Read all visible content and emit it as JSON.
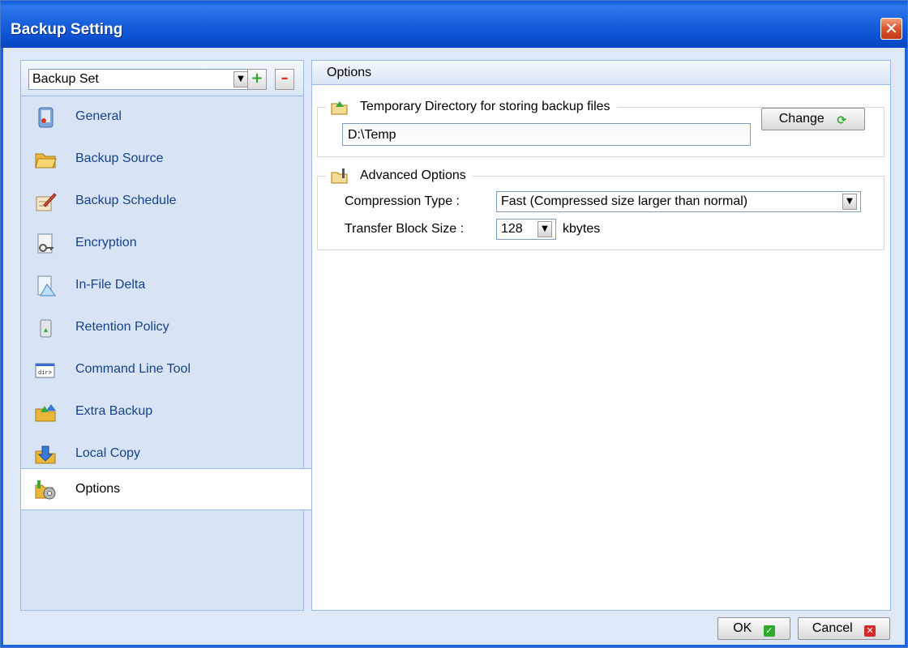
{
  "window": {
    "title": "Backup Setting",
    "close_symbol": "✕"
  },
  "sidebar": {
    "backup_set_select": {
      "value": "Backup Set",
      "arrow": "▼"
    },
    "add_symbol": "+",
    "remove_symbol": "–",
    "items": [
      {
        "label": "General",
        "icon": "general-icon"
      },
      {
        "label": "Backup Source",
        "icon": "folder-icon"
      },
      {
        "label": "Backup Schedule",
        "icon": "schedule-icon"
      },
      {
        "label": "Encryption",
        "icon": "key-icon"
      },
      {
        "label": "In-File Delta",
        "icon": "delta-icon"
      },
      {
        "label": "Retention Policy",
        "icon": "recycle-bin-icon"
      },
      {
        "label": "Command Line Tool",
        "icon": "command-line-icon"
      },
      {
        "label": "Extra Backup",
        "icon": "extra-backup-icon"
      },
      {
        "label": "Local Copy",
        "icon": "local-copy-icon"
      },
      {
        "label": "Options",
        "icon": "options-gear-icon",
        "selected": true
      }
    ],
    "command_line_icon_text": "dir>"
  },
  "panel": {
    "title": "Options",
    "temp_dir": {
      "legend": "Temporary Directory for storing backup files",
      "value": "D:\\Temp",
      "change_label": "Change"
    },
    "advanced": {
      "legend": "Advanced Options",
      "compression_label": "Compression Type :",
      "compression_value": "Fast (Compressed size larger than normal)",
      "block_size_label": "Transfer Block Size :",
      "block_size_value": "128",
      "block_size_unit": "kbytes"
    }
  },
  "footer": {
    "ok_label": "OK",
    "cancel_label": "Cancel"
  },
  "colors": {
    "title_bar": "#0b4fcf",
    "nav_label": "#15428b",
    "ok_badge": "#2eaa2e",
    "cancel_badge": "#d42a2a",
    "panel_border": "#99bbe8"
  }
}
